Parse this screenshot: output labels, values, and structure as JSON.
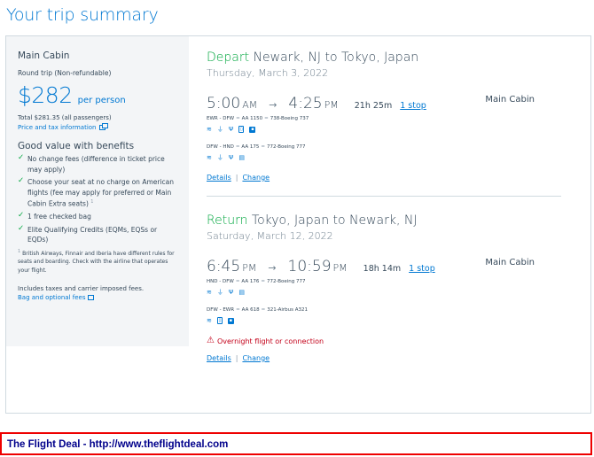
{
  "page": {
    "title": "Your trip summary"
  },
  "sidebar": {
    "cabin": "Main Cabin",
    "trip_type": "Round trip (Non-refundable)",
    "price": "$282",
    "price_unit": "per person",
    "total": "Total $281.35 (all passengers)",
    "price_tax_link": "Price and tax information",
    "benefits_heading": "Good value with benefits",
    "benefits": [
      "No change fees (difference in ticket price may apply)",
      "Choose your seat at no charge on American flights (fee may apply for preferred or Main Cabin Extra seats)",
      "1 free checked bag",
      "Elite Qualifying Credits (EQMs, EQSs or EQDs)"
    ],
    "benefit_footnote_marker": "1",
    "footnote": "British Airways, Finnair and Iberia have different rules for seats and boarding. Check with the airline that operates your flight.",
    "footnote_marker": "1",
    "taxes_note": "Includes taxes and carrier imposed fees.",
    "bag_link": "Bag and optional fees"
  },
  "depart": {
    "direction": "Depart",
    "route": "Newark, NJ to Tokyo, Japan",
    "date": "Thursday, March 3, 2022",
    "dep_time": "5:00",
    "dep_ampm": "AM",
    "arr_time": "4:25",
    "arr_ampm": "PM",
    "duration": "21h 25m",
    "stops": "1 stop",
    "cabin": "Main Cabin",
    "legs": [
      {
        "route": "EWR - DFW",
        "flight": "AA 1150",
        "aircraft": "738-Boeing 737"
      },
      {
        "route": "DFW - HND",
        "flight": "AA 175",
        "aircraft": "772-Boeing 777"
      }
    ],
    "details_link": "Details",
    "change_link": "Change"
  },
  "return": {
    "direction": "Return",
    "route": "Tokyo, Japan to Newark, NJ",
    "date": "Saturday, March 12, 2022",
    "dep_time": "6:45",
    "dep_ampm": "PM",
    "arr_time": "10:59",
    "arr_ampm": "PM",
    "duration": "18h 14m",
    "stops": "1 stop",
    "cabin": "Main Cabin",
    "legs": [
      {
        "route": "HND - DFW",
        "flight": "AA 176",
        "aircraft": "772-Boeing 777"
      },
      {
        "route": "DFW - EWR",
        "flight": "AA 618",
        "aircraft": "321-Airbus A321"
      }
    ],
    "warning": "Overnight flight or connection",
    "details_link": "Details",
    "change_link": "Change"
  },
  "footer": {
    "text": "The Flight Deal - http://www.theflightdeal.com"
  },
  "colors": {
    "brand_blue": "#0078d2",
    "green": "#00a63e",
    "warning_red": "#c30019",
    "footer_border": "#ee0000"
  },
  "icons": {
    "amenities": [
      "wifi-icon",
      "power-outlet-icon",
      "usb-icon",
      "device-entertainment-icon",
      "seatback-entertainment-icon"
    ],
    "check": "check-icon",
    "external": "external-link-icon",
    "warning": "warning-triangle-icon"
  }
}
